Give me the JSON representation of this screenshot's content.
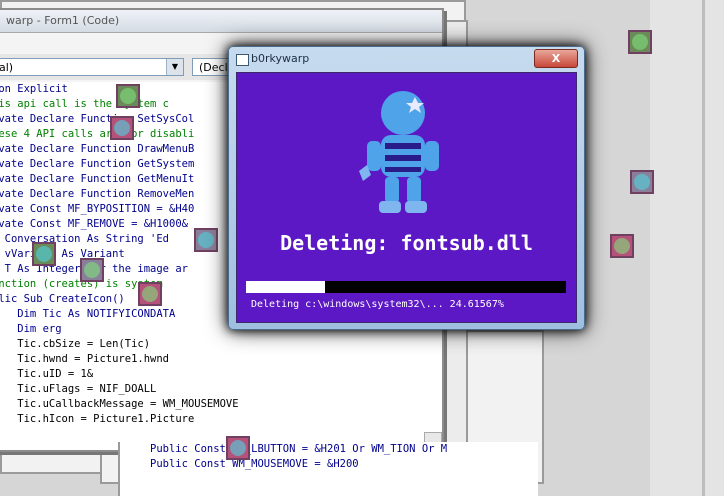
{
  "code_window": {
    "title": "warp - Form1 (Code)",
    "object_combo": "al)",
    "proc_combo": "(Decla"
  },
  "code_lines": [
    {
      "text": "ion Explicit",
      "style": "kw"
    },
    {
      "text": "his api call is the system c",
      "style": "cm"
    },
    {
      "text": "ivate Declare Function SetSysCol",
      "style": "kw"
    },
    {
      "text": "hese 4 API calls are for disabli",
      "style": "cm"
    },
    {
      "text": "ivate Declare Function DrawMenuB",
      "style": "kw"
    },
    {
      "text": "ivate Declare Function GetSystem",
      "style": "kw"
    },
    {
      "text": "ivate Declare Function GetMenuIt",
      "style": "kw"
    },
    {
      "text": "ivate Declare Function RemoveMen",
      "style": "kw"
    },
    {
      "text": "",
      "style": ""
    },
    {
      "text": "ivate Const MF_BYPOSITION = &H40",
      "style": "kw"
    },
    {
      "text": "ivate Const MF_REMOVE = &H1000&",
      "style": "kw"
    },
    {
      "text": "",
      "style": ""
    },
    {
      "text": "m Conversation As String 'Ed",
      "style": "kw"
    },
    {
      "text": "m vVariant As Variant",
      "style": "kw"
    },
    {
      "text": "m T As Integer for the image ar",
      "style": "kw"
    },
    {
      "text": "unction (creates) is system",
      "style": "cm"
    },
    {
      "text": "blic Sub CreateIcon()",
      "style": "kw"
    },
    {
      "text": "    Dim Tic As NOTIFYICONDATA",
      "style": "kw"
    },
    {
      "text": "    Dim erg",
      "style": "kw"
    },
    {
      "text": "    Tic.cbSize = Len(Tic)",
      "style": ""
    },
    {
      "text": "    Tic.hwnd = Picture1.hwnd",
      "style": ""
    },
    {
      "text": "    Tic.uID = 1&",
      "style": ""
    },
    {
      "text": "    Tic.uFlags = NIF_DOALL",
      "style": ""
    },
    {
      "text": "    Tic.uCallbackMessage = WM_MOUSEMOVE",
      "style": ""
    },
    {
      "text": "    Tic.hIcon = Picture1.Picture",
      "style": ""
    }
  ],
  "lower_code_lines": [
    "Public Const WM_LBUTTON = &H201 Or WM_TION Or M",
    "Public Const WM_MOUSEMOVE = &H200"
  ],
  "dialog": {
    "title": "b0rkywarp",
    "close_label": "X",
    "heading": "Deleting: fontsub.dll",
    "status": "Deleting c:\\windows\\system32\\... 24.61567%",
    "progress": 0.2461567,
    "bg_color": "#5b18c4",
    "astronaut_color": "#4fa3e8"
  },
  "stickers": [
    {
      "name": "alien-sticker-icon"
    },
    {
      "name": "smiley-sticker-icon"
    },
    {
      "name": "tongue-sticker-icon"
    },
    {
      "name": "skull-sticker-icon"
    },
    {
      "name": "tongue-sticker-icon"
    },
    {
      "name": "smiley-sticker-icon"
    },
    {
      "name": "alien-sticker-icon"
    },
    {
      "name": "tongue-sticker-icon"
    },
    {
      "name": "skull-sticker-icon"
    },
    {
      "name": "smiley-sticker-icon"
    }
  ]
}
